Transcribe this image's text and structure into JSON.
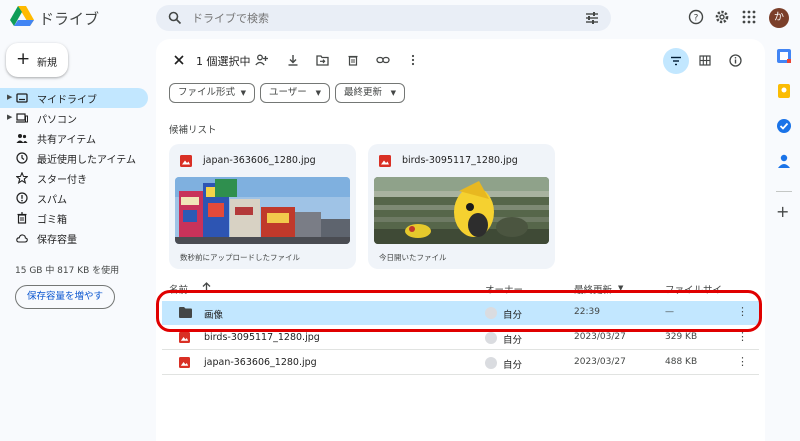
{
  "app": {
    "title": "ドライブ"
  },
  "search": {
    "placeholder": "ドライブで検索"
  },
  "header": {
    "avatar_initial": "か"
  },
  "sidebar": {
    "new_label": "新規",
    "items": [
      {
        "label": "マイドライブ",
        "icon": "my-drive-icon",
        "active": true
      },
      {
        "label": "パソコン",
        "icon": "computers-icon"
      },
      {
        "label": "共有アイテム",
        "icon": "shared-icon"
      },
      {
        "label": "最近使用したアイテム",
        "icon": "clock-icon"
      },
      {
        "label": "スター付き",
        "icon": "star-icon"
      },
      {
        "label": "スパム",
        "icon": "spam-icon"
      },
      {
        "label": "ゴミ箱",
        "icon": "trash-icon"
      },
      {
        "label": "保存容量",
        "icon": "cloud-icon"
      }
    ],
    "storage_text": "15 GB 中 817 KB を使用",
    "storage_button": "保存容量を増やす"
  },
  "action_bar": {
    "selection_count": "1 個選択中"
  },
  "filters": {
    "file_type": "ファイル形式",
    "user": "ユーザー",
    "last_modified": "最終更新"
  },
  "suggested": {
    "title": "候補リスト",
    "cards": [
      {
        "name": "japan-363606_1280.jpg",
        "meta": "数秒前にアップロードしたファイル"
      },
      {
        "name": "birds-3095117_1280.jpg",
        "meta": "今日開いたファイル"
      }
    ]
  },
  "table": {
    "headers": {
      "name": "名前",
      "owner": "オーナー",
      "modified": "最終更新",
      "size": "ファイルサイ"
    },
    "rows": [
      {
        "name": "画像",
        "type": "folder",
        "owner": "自分",
        "modified": "22:39",
        "size": "—",
        "selected": true
      },
      {
        "name": "birds-3095117_1280.jpg",
        "type": "image",
        "owner": "自分",
        "modified": "2023/03/27",
        "size": "329 KB"
      },
      {
        "name": "japan-363606_1280.jpg",
        "type": "image",
        "owner": "自分",
        "modified": "2023/03/27",
        "size": "488 KB"
      }
    ]
  },
  "colors": {
    "accent": "#0b57d0",
    "selected_bg": "#c2e7ff",
    "image_icon": "#d93025",
    "highlight": "#e00000"
  }
}
